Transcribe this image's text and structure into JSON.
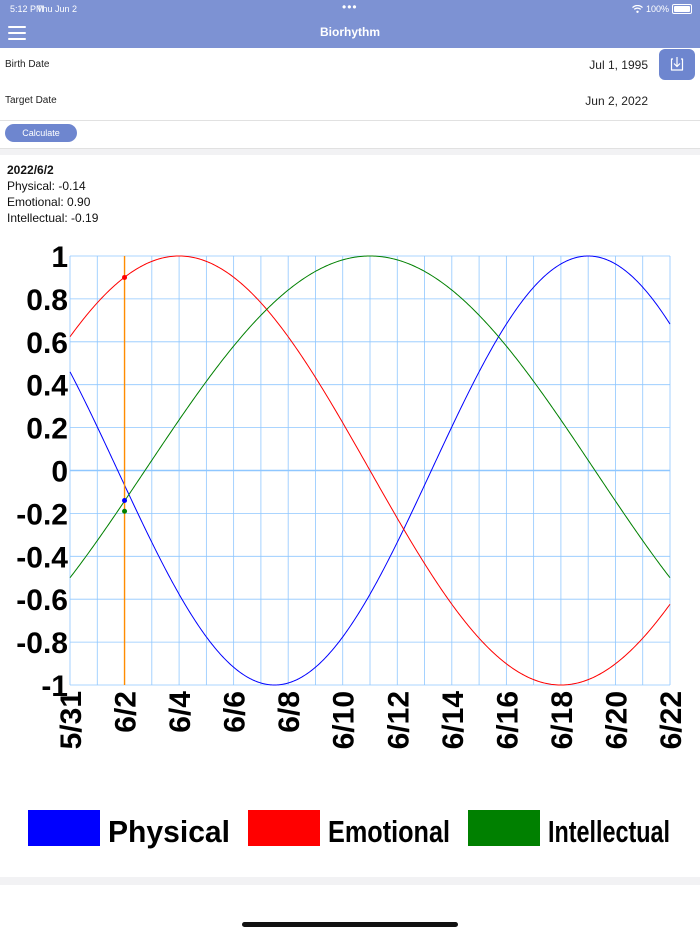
{
  "status_bar": {
    "time": "5:12 PM",
    "date": "Thu Jun 2",
    "dots": "•••",
    "battery": "100%"
  },
  "header": {
    "title": "Biorhythm",
    "menu_icon": "hamburger-icon"
  },
  "form": {
    "birth_label": "Birth Date",
    "birth_value": "Jul 1, 1995",
    "target_label": "Target Date",
    "target_value": "Jun 2, 2022",
    "save_icon": "download-tray-icon",
    "calculate_label": "Calculate"
  },
  "result": {
    "date": "2022/6/2",
    "physical": "Physical: -0.14",
    "emotional": "Emotional: 0.90",
    "intellectual": "Intellectual: -0.19"
  },
  "colors": {
    "header": "#7d92d3",
    "button": "#6e86cf",
    "physical": "#0000ff",
    "emotional": "#ff0000",
    "intellectual": "#008000",
    "marker": "#ff8c00",
    "grid": "#8fc7ff"
  },
  "chart_data": {
    "type": "line",
    "x_start_date": "2022-05-31",
    "x_end_date": "2022-06-22",
    "x_tick_labels": [
      "5/31",
      "6/2",
      "6/4",
      "6/6",
      "6/8",
      "6/10",
      "6/12",
      "6/14",
      "6/16",
      "6/18",
      "6/20",
      "6/22"
    ],
    "y_tick_labels": [
      "1",
      "0.8",
      "0.6",
      "0.4",
      "0.2",
      "0",
      "-0.2",
      "-0.4",
      "-0.6",
      "-0.8",
      "-1"
    ],
    "ylim": [
      -1,
      1
    ],
    "grid": true,
    "legend_position": "bottom",
    "marker_date": "2022-06-02",
    "series": [
      {
        "name": "Physical",
        "period_days": 23,
        "peak_date": "2022-06-19"
      },
      {
        "name": "Emotional",
        "period_days": 28,
        "peak_date": "2022-06-04"
      },
      {
        "name": "Intellectual",
        "period_days": 33,
        "peak_date": "2022-06-11"
      }
    ],
    "marker_values": [
      {
        "name": "Physical",
        "value": -0.14
      },
      {
        "name": "Emotional",
        "value": 0.9
      },
      {
        "name": "Intellectual",
        "value": -0.19
      }
    ]
  }
}
